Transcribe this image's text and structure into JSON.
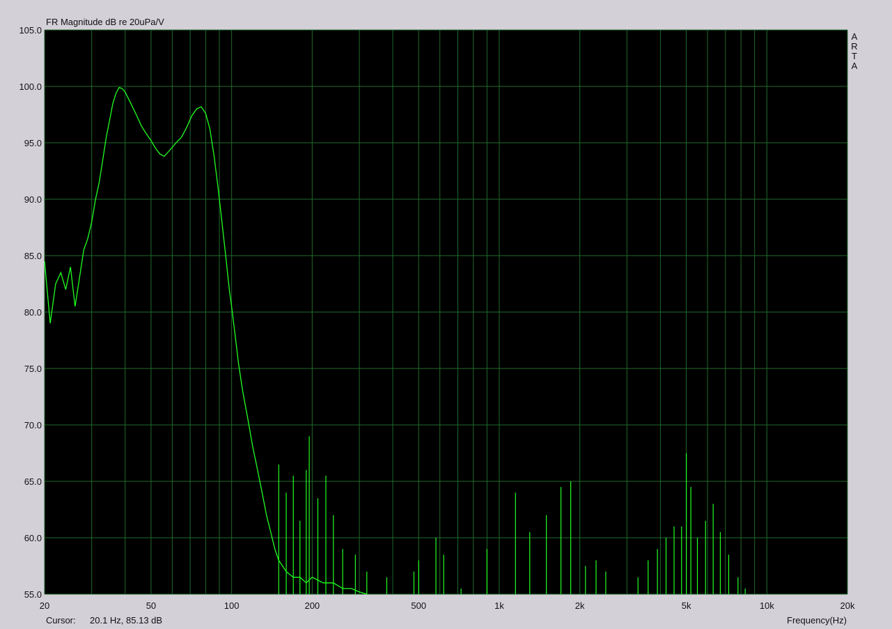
{
  "window": {
    "cursor_label": "Cursor:",
    "cursor_value": "20.1 Hz, 85.13 dB",
    "side_label": [
      "A",
      "R",
      "T",
      "A"
    ]
  },
  "colors": {
    "background": "#d4d0d8",
    "plot_background": "#000000",
    "grid": "#1f6b2a",
    "trace": "#22ff22"
  },
  "chart_data": {
    "type": "line",
    "title": "FR Magnitude dB re 20uPa/V",
    "xlabel": "Frequency(Hz)",
    "ylabel": "",
    "xscale": "log",
    "xlim": [
      20,
      20000
    ],
    "ylim": [
      55,
      105
    ],
    "x_tick_labels": [
      {
        "value": 20,
        "label": "20"
      },
      {
        "value": 50,
        "label": "50"
      },
      {
        "value": 100,
        "label": "100"
      },
      {
        "value": 200,
        "label": "200"
      },
      {
        "value": 500,
        "label": "500"
      },
      {
        "value": 1000,
        "label": "1k"
      },
      {
        "value": 2000,
        "label": "2k"
      },
      {
        "value": 5000,
        "label": "5k"
      },
      {
        "value": 10000,
        "label": "10k"
      },
      {
        "value": 20000,
        "label": "20k"
      }
    ],
    "y_tick_labels": [
      "55.0",
      "60.0",
      "65.0",
      "70.0",
      "75.0",
      "80.0",
      "85.0",
      "90.0",
      "95.0",
      "100.0",
      "105.0"
    ],
    "y_ticks": [
      55,
      60,
      65,
      70,
      75,
      80,
      85,
      90,
      95,
      100,
      105
    ],
    "grid": true,
    "series": [
      {
        "color": "#22ff22",
        "x": [
          20,
          21,
          22,
          23,
          24,
          25,
          26,
          27,
          28,
          29,
          30,
          31,
          32,
          33,
          34,
          35,
          36,
          37,
          38,
          39,
          40,
          42,
          44,
          46,
          48,
          50,
          52,
          54,
          56,
          58,
          60,
          62,
          65,
          68,
          71,
          74,
          77,
          80,
          83,
          86,
          89,
          92,
          95,
          98,
          100,
          103,
          106,
          110,
          115,
          120,
          125,
          130,
          135,
          140,
          145,
          150,
          160,
          170,
          180,
          190,
          200,
          220,
          240,
          260,
          280,
          300,
          320
        ],
        "y": [
          84.5,
          79.0,
          82.5,
          83.5,
          82.0,
          84.0,
          80.5,
          83.0,
          85.5,
          86.5,
          88.0,
          90.0,
          91.5,
          93.5,
          95.5,
          97.0,
          98.5,
          99.4,
          99.9,
          99.8,
          99.5,
          98.5,
          97.5,
          96.5,
          95.8,
          95.2,
          94.5,
          94.0,
          93.8,
          94.2,
          94.6,
          95.0,
          95.5,
          96.4,
          97.4,
          98.0,
          98.2,
          97.6,
          96.2,
          93.8,
          91.0,
          88.0,
          85.0,
          82.0,
          80.5,
          78.0,
          75.5,
          73.0,
          70.5,
          68.0,
          66.0,
          64.0,
          62.0,
          60.5,
          59.0,
          58.0,
          57.0,
          56.5,
          56.5,
          56.0,
          56.5,
          56.0,
          56.0,
          55.5,
          55.5,
          55.2,
          55.0
        ]
      }
    ],
    "spikes": [
      {
        "x": 150,
        "y": 66.5
      },
      {
        "x": 160,
        "y": 64.0
      },
      {
        "x": 170,
        "y": 65.5
      },
      {
        "x": 180,
        "y": 61.5
      },
      {
        "x": 190,
        "y": 66.0
      },
      {
        "x": 195,
        "y": 69.0
      },
      {
        "x": 210,
        "y": 63.5
      },
      {
        "x": 225,
        "y": 65.5
      },
      {
        "x": 240,
        "y": 62.0
      },
      {
        "x": 260,
        "y": 59.0
      },
      {
        "x": 290,
        "y": 58.5
      },
      {
        "x": 320,
        "y": 57.0
      },
      {
        "x": 380,
        "y": 56.5
      },
      {
        "x": 480,
        "y": 57.0
      },
      {
        "x": 500,
        "y": 58.0
      },
      {
        "x": 580,
        "y": 60.0
      },
      {
        "x": 620,
        "y": 58.5
      },
      {
        "x": 720,
        "y": 55.5
      },
      {
        "x": 900,
        "y": 59.0
      },
      {
        "x": 1150,
        "y": 64.0
      },
      {
        "x": 1300,
        "y": 60.5
      },
      {
        "x": 1500,
        "y": 62.0
      },
      {
        "x": 1700,
        "y": 64.5
      },
      {
        "x": 1850,
        "y": 65.0
      },
      {
        "x": 2100,
        "y": 57.5
      },
      {
        "x": 2300,
        "y": 58.0
      },
      {
        "x": 2500,
        "y": 57.0
      },
      {
        "x": 3300,
        "y": 56.5
      },
      {
        "x": 3600,
        "y": 58.0
      },
      {
        "x": 3900,
        "y": 59.0
      },
      {
        "x": 4200,
        "y": 60.0
      },
      {
        "x": 4500,
        "y": 61.0
      },
      {
        "x": 4800,
        "y": 61.0
      },
      {
        "x": 5000,
        "y": 67.5
      },
      {
        "x": 5200,
        "y": 64.5
      },
      {
        "x": 5500,
        "y": 60.0
      },
      {
        "x": 5900,
        "y": 61.5
      },
      {
        "x": 6300,
        "y": 63.0
      },
      {
        "x": 6700,
        "y": 60.5
      },
      {
        "x": 7200,
        "y": 58.5
      },
      {
        "x": 7800,
        "y": 56.5
      },
      {
        "x": 8300,
        "y": 55.5
      }
    ]
  }
}
